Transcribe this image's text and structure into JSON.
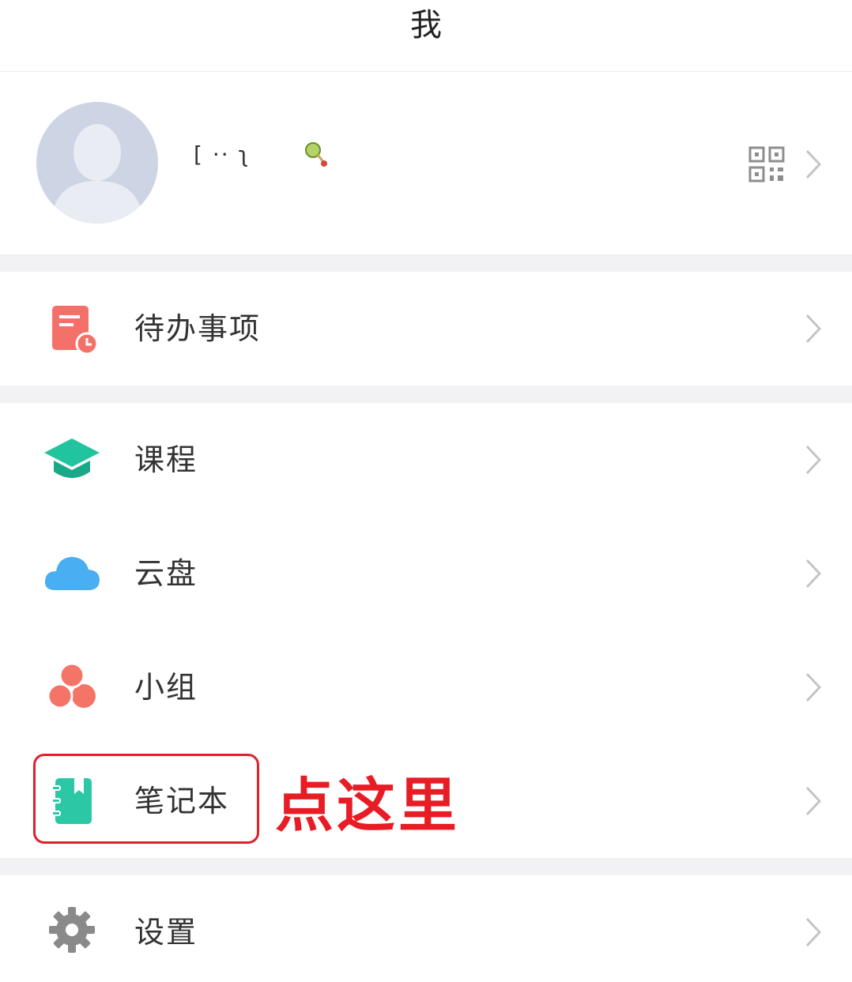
{
  "header": {
    "title": "我"
  },
  "profile": {
    "username": "[   ·· ʅ",
    "avatar_icon": "default-user-avatar",
    "badge_icon": "rattle-badge-icon",
    "qr_icon": "qr-code-icon"
  },
  "menu": {
    "todo": {
      "label": "待办事项",
      "icon": "todo-clock-icon",
      "color": "#f4716a"
    },
    "course": {
      "label": "课程",
      "icon": "graduation-cap-icon",
      "color": "#22c4a0"
    },
    "cloud": {
      "label": "云盘",
      "icon": "cloud-icon",
      "color": "#4aaef2"
    },
    "group": {
      "label": "小组",
      "icon": "group-circles-icon",
      "color": "#f47468"
    },
    "notebook": {
      "label": "笔记本",
      "icon": "notebook-icon",
      "color": "#2cc8a6"
    },
    "settings": {
      "label": "设置",
      "icon": "gear-icon",
      "color": "#8a8a8a"
    }
  },
  "annotation": {
    "text": "点这里",
    "color": "#e81c25"
  },
  "colors": {
    "divider": "#f2f2f4",
    "chevron": "#c4c4c4",
    "text": "#333333"
  }
}
